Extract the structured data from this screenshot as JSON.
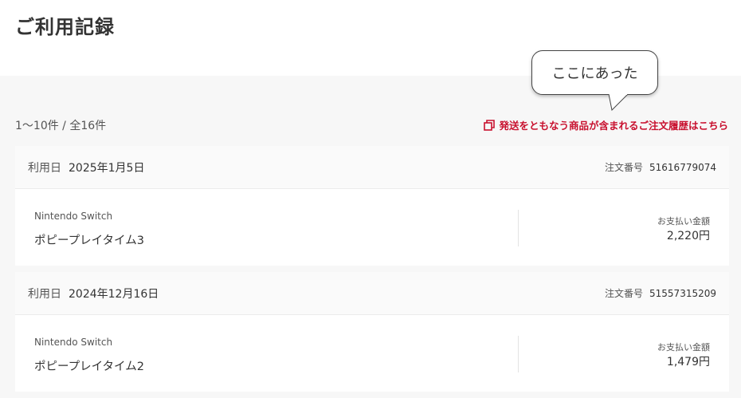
{
  "page": {
    "title": "ご利用記録"
  },
  "summary": {
    "count_text": "1〜10件 / 全16件",
    "shipping_link_label": "発送をともなう商品が含まれるご注文履歴はこちら"
  },
  "callout": {
    "text": "ここにあった"
  },
  "colors": {
    "accent": "#c8102e",
    "background": "#f7f7f7",
    "card": "#ffffff"
  },
  "records": [
    {
      "date_label": "利用日",
      "date": "2025年1月5日",
      "order_label": "注文番号",
      "order_number": "51616779074",
      "platform": "Nintendo Switch",
      "title": "ポピープレイタイム3",
      "payment_label": "お支払い金額",
      "amount": "2,220円"
    },
    {
      "date_label": "利用日",
      "date": "2024年12月16日",
      "order_label": "注文番号",
      "order_number": "51557315209",
      "platform": "Nintendo Switch",
      "title": "ポピープレイタイム2",
      "payment_label": "お支払い金額",
      "amount": "1,479円"
    }
  ]
}
